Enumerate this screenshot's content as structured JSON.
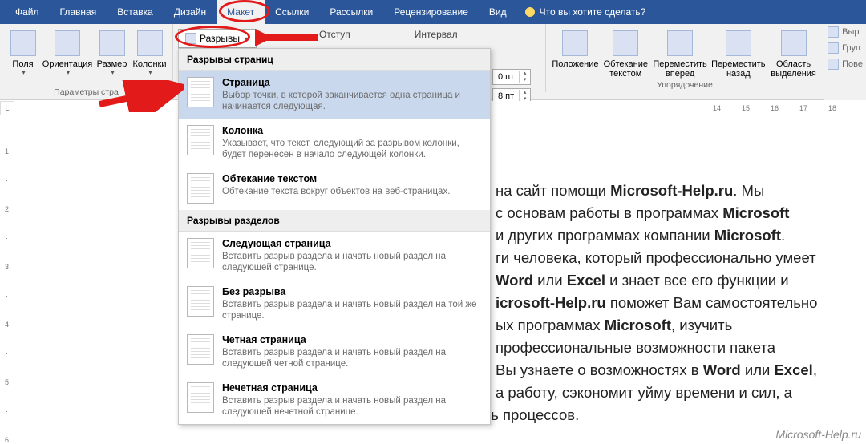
{
  "tabs": {
    "file": "Файл",
    "home": "Главная",
    "insert": "Вставка",
    "design": "Дизайн",
    "layout": "Макет",
    "links": "Ссылки",
    "mailings": "Рассылки",
    "review": "Рецензирование",
    "view": "Вид",
    "tell_me": "Что вы хотите сделать?"
  },
  "ribbon": {
    "margins": "Поля",
    "orientation": "Ориентация",
    "size": "Размер",
    "columns": "Колонки",
    "breaks_btn": "Разрывы",
    "page_setup_group": "Параметры стра",
    "indent_label": "Отступ",
    "spacing_label": "Интервал",
    "spacing_value_1": "0 пт",
    "spacing_value_2": "8 пт",
    "position": "Положение",
    "wrap_text": "Обтекание текстом",
    "bring_forward": "Переместить вперед",
    "send_backward": "Переместить назад",
    "selection_pane": "Область выделения",
    "arrange_group": "Упорядочение",
    "align": "Выр",
    "group": "Груп",
    "rotate": "Пове"
  },
  "breaks_menu": {
    "section_pages": "Разрывы страниц",
    "page_title": "Страница",
    "page_desc": "Выбор точки, в которой заканчивается одна страница и начинается следующая.",
    "column_title": "Колонка",
    "column_desc": "Указывает, что текст, следующий за разрывом колонки, будет перенесен в начало следующей колонки.",
    "textwrap_title": "Обтекание текстом",
    "textwrap_desc": "Обтекание текста вокруг объектов на веб-страницах.",
    "section_sections": "Разрывы разделов",
    "next_title": "Следующая страница",
    "next_desc": "Вставить разрыв раздела и начать новый раздел на следующей странице.",
    "continuous_title": "Без разрыва",
    "continuous_desc": "Вставить разрыв раздела и начать новый раздел на той же странице.",
    "even_title": "Четная страница",
    "even_desc": "Вставить разрыв раздела и начать новый раздел на следующей четной странице.",
    "odd_title": "Нечетная страница",
    "odd_desc": "Вставить разрыв раздела и начать новый раздел на следующей нечетной странице."
  },
  "doc": {
    "line1a": "на сайт помощи ",
    "line1b": "Microsoft-Help.ru",
    "line1c": ". Мы",
    "line2a": "с основам работы в программах ",
    "line2b": "Microsoft",
    "line3a": " и других программах компании ",
    "line3b": "Microsoft",
    "line3c": ".",
    "line4": "ги человека, который профессионально умеет",
    "line5a": "Word",
    "line5b": " или ",
    "line5c": "Excel",
    "line5d": " и знает все его функции и",
    "line6a": "icrosoft-Help.ru",
    "line6b": " поможет Вам самостоятельно",
    "line7a": "ых программах ",
    "line7b": "Microsoft",
    "line7c": ", изучить",
    "line8": "профессиональные возможности пакета",
    "line9a": " Вы узнаете о возможностях в ",
    "line9b": "Word",
    "line9c": " или ",
    "line9d": "Excel",
    "line9e": ",",
    "line10": "а работу, сэкономит уйму времени и сил, а",
    "line11": "также позволят вам автоматизировать часть процессов."
  },
  "watermark": "Microsoft-Help.ru",
  "ruler": {
    "L": "L",
    "n14": "14",
    "n15": "15",
    "n16": "16",
    "n17": "17",
    "n18": "18"
  }
}
